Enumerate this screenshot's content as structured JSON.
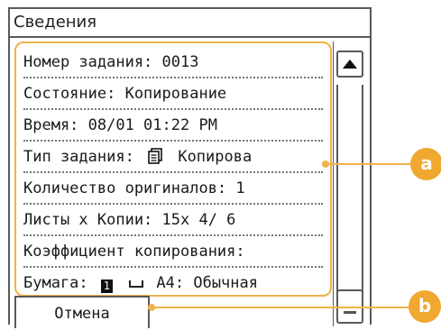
{
  "window": {
    "title": "Сведения"
  },
  "rows": [
    {
      "text": "Номер задания: 0013"
    },
    {
      "text": "Состояние: Копирование"
    },
    {
      "text": "Время: 08/01 01:22 PM"
    },
    {
      "label": "Тип задания:",
      "icon": "copy-job-icon",
      "value": "Копирова"
    },
    {
      "text": "Количество оригиналов: 1"
    },
    {
      "text": "Листы x Копии: 15x 4/ 6"
    },
    {
      "text": "Коэффициент копирования:"
    },
    {
      "label": "Бумага:",
      "box_number": "1",
      "icon": "paper-tray-icon",
      "value": "A4: Обычная"
    }
  ],
  "buttons": {
    "cancel": "Отмена"
  },
  "callouts": {
    "a": "a",
    "b": "b"
  },
  "colors": {
    "accent": "#f0b24a",
    "border": "#5a5a5a"
  }
}
